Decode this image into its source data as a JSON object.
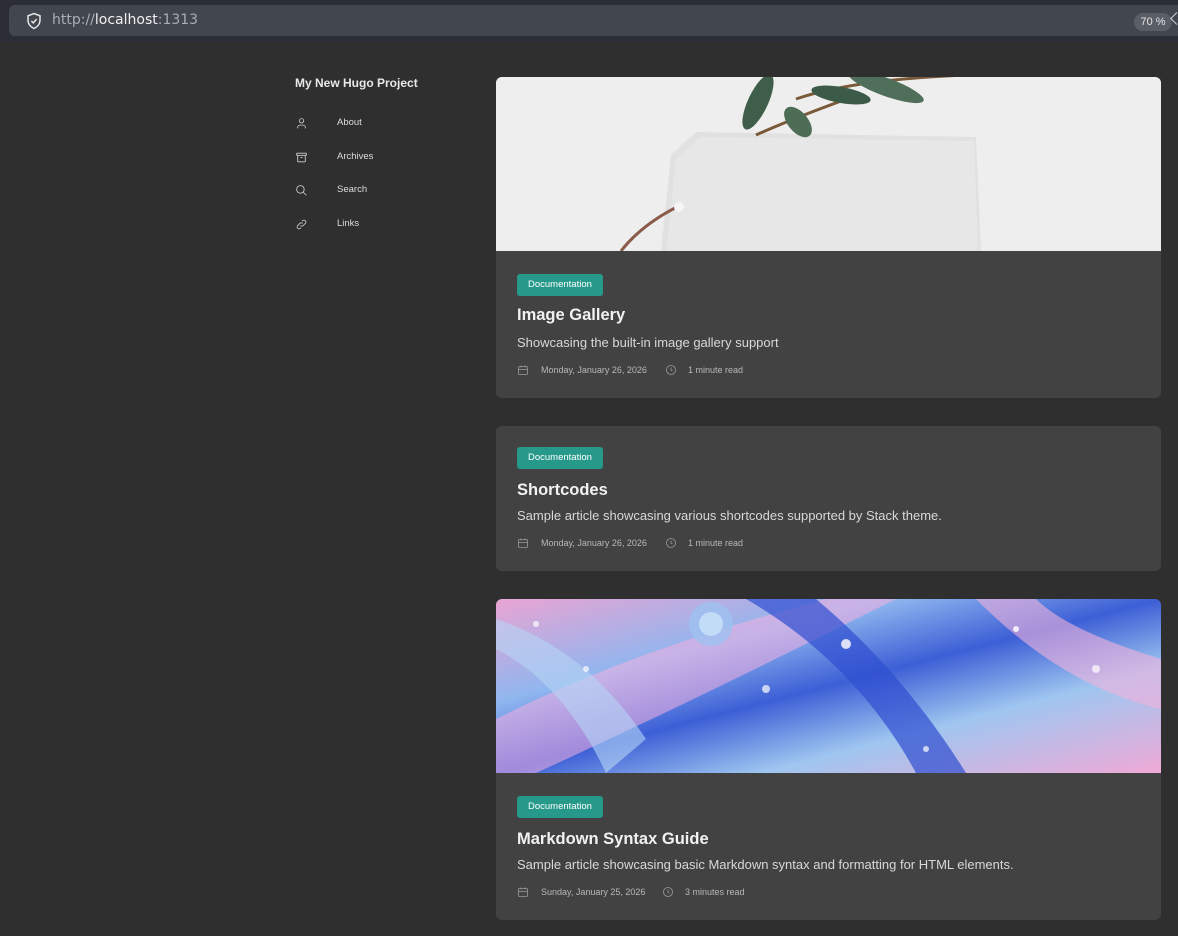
{
  "browser": {
    "url_protocol": "http://",
    "url_host": "localhost",
    "url_port": ":1313",
    "zoom": "70 %"
  },
  "sidebar": {
    "title": "My New Hugo Project",
    "items": [
      {
        "label": "About",
        "icon": "user-icon"
      },
      {
        "label": "Archives",
        "icon": "archive-icon"
      },
      {
        "label": "Search",
        "icon": "search-icon"
      },
      {
        "label": "Links",
        "icon": "link-icon"
      }
    ]
  },
  "articles": [
    {
      "category": "Documentation",
      "title": "Image Gallery",
      "subtitle": "Showcasing the built-in image gallery support",
      "date": "Monday, January 26, 2026",
      "read_time": "1 minute read"
    },
    {
      "category": "Documentation",
      "title": "Shortcodes",
      "subtitle": "Sample article showcasing various shortcodes supported by Stack theme.",
      "date": "Monday, January 26, 2026",
      "read_time": "1 minute read"
    },
    {
      "category": "Documentation",
      "title": "Markdown Syntax Guide",
      "subtitle": "Sample article showcasing basic Markdown syntax and formatting for HTML elements.",
      "date": "Sunday, January 25, 2026",
      "read_time": "3 minutes read"
    }
  ],
  "colors": {
    "background": "#2f2f2f",
    "card": "#424242",
    "tag": "#27998a"
  }
}
